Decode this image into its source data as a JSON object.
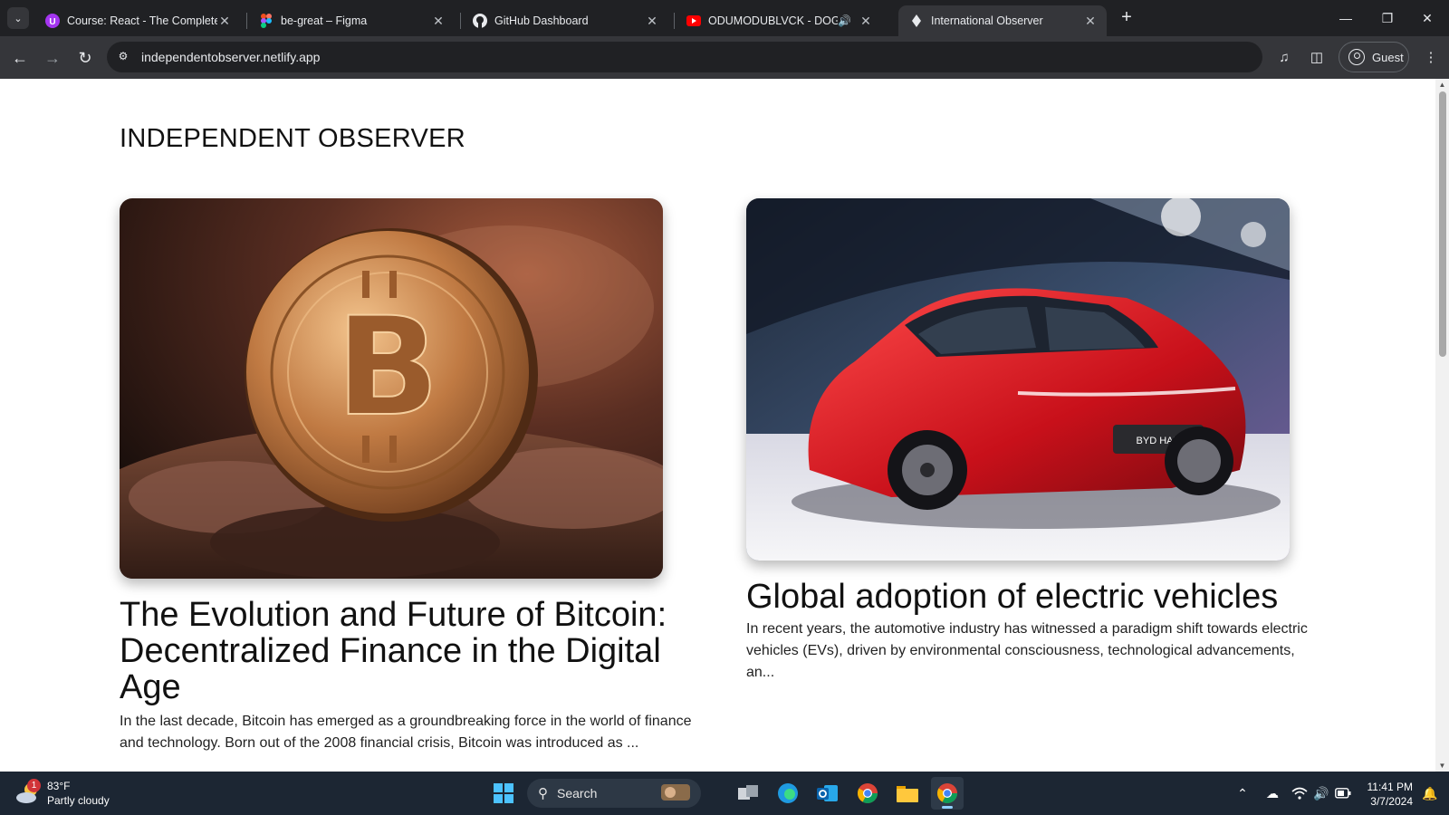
{
  "browser": {
    "tabs": [
      {
        "title": "Course: React - The Complete G",
        "favicon": "udemy-icon",
        "active": false
      },
      {
        "title": "be-great – Figma",
        "favicon": "figma-icon",
        "active": false
      },
      {
        "title": "GitHub Dashboard",
        "favicon": "github-icon",
        "active": false
      },
      {
        "title": "ODUMODUBLVCK - DOG EA",
        "favicon": "youtube-icon",
        "active": false,
        "audio": true
      },
      {
        "title": "International Observer",
        "favicon": "netlify-icon",
        "active": true
      }
    ],
    "url": "independentobserver.netlify.app",
    "profile_label": "Guest"
  },
  "page": {
    "brand": "INDEPENDENT OBSERVER",
    "articles": [
      {
        "image": "bitcoin-coin-image",
        "title": "The Evolution and Future of Bitcoin: Decentralized Finance in the Digital Age",
        "excerpt": "In the last decade, Bitcoin has emerged as a groundbreaking force in the world of finance and technology. Born out of the 2008 financial crisis, Bitcoin was introduced as ..."
      },
      {
        "image": "red-electric-car-image",
        "badge_text": "BYD HAN",
        "title": "Global adoption of electric vehicles",
        "excerpt": "In recent years, the automotive industry has witnessed a paradigm shift towards electric vehicles (EVs), driven by environmental consciousness, technological advancements, an..."
      }
    ]
  },
  "taskbar": {
    "weather": {
      "temp": "83°F",
      "condition": "Partly cloudy",
      "badge": "1"
    },
    "search_label": "Search",
    "time": "11:41 PM",
    "date": "3/7/2024"
  },
  "colors": {
    "tab_strip": "#202124",
    "toolbar": "#35363a",
    "page_bg": "#ffffff",
    "taskbar": "#1c2633"
  }
}
